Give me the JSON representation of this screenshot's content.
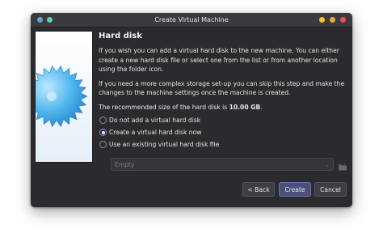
{
  "window": {
    "title": "Create Virtual Machine"
  },
  "page": {
    "heading": "Hard disk",
    "paragraph1": "If you wish you can add a virtual hard disk to the new machine. You can either create a new hard disk file or select one from the list or from another location using the folder icon.",
    "paragraph2": "If you need a more complex storage set-up you can skip this step and make the changes to the machine settings once the machine is created.",
    "recommended_prefix": "The recommended size of the hard disk is ",
    "recommended_size": "10.00 GB",
    "recommended_suffix": "."
  },
  "options": [
    {
      "label": "Do not add a virtual hard disk",
      "checked": false
    },
    {
      "label": "Create a virtual hard disk now",
      "checked": true
    },
    {
      "label": "Use an existing virtual hard disk file",
      "checked": false
    }
  ],
  "disk_combo": {
    "value": "Empty",
    "icon": "chevron-down-icon"
  },
  "buttons": {
    "back": "< Back",
    "create": "Create",
    "cancel": "Cancel"
  },
  "colors": {
    "window_bg": "#2b2b2f",
    "accent": "#7a86e0",
    "close": "#ef4d5a",
    "minimize": "#f5c518",
    "maximize": "#f0a43a"
  }
}
